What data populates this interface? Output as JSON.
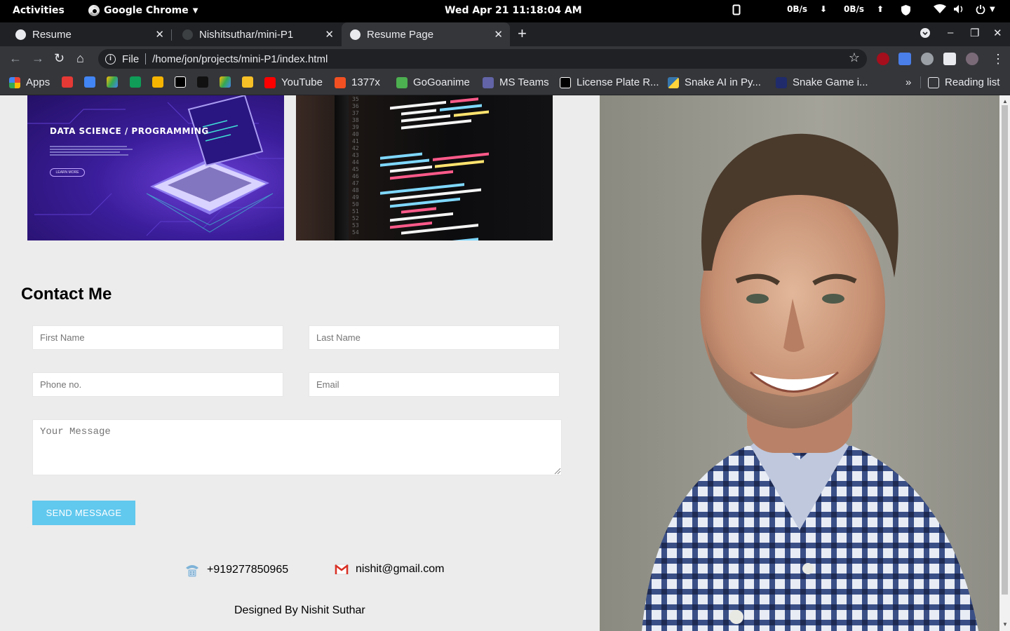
{
  "system_bar": {
    "activities": "Activities",
    "app_name": "Google Chrome",
    "clock": "Wed Apr 21  11:18:04 AM",
    "net_down": "0B/s",
    "net_up": "0B/s"
  },
  "tabs": [
    {
      "title": "Resume",
      "active": false
    },
    {
      "title": "Nishitsuthar/mini-P1",
      "active": false
    },
    {
      "title": "Resume Page",
      "active": true
    }
  ],
  "toolbar": {
    "scheme_label": "File",
    "url": "/home/jon/projects/mini-P1/index.html"
  },
  "bookmarks": {
    "apps": "Apps",
    "items": [
      "YouTube",
      "1377x",
      "GoGoanime",
      "MS Teams",
      "License Plate R...",
      "Snake AI in Py...",
      "Snake Game i..."
    ],
    "overflow": "»",
    "reading_list": "Reading list"
  },
  "page": {
    "card_ds": {
      "title": "DATA SCIENCE / PROGRAMMING",
      "button": "LEARN MORE"
    },
    "contact": {
      "title": "Contact Me",
      "first_name_placeholder": "First Name",
      "last_name_placeholder": "Last Name",
      "phone_placeholder": "Phone no.",
      "email_placeholder": "Email",
      "message_placeholder": "Your Message",
      "send_label": "SEND MESSAGE"
    },
    "info": {
      "phone": "+919277850965",
      "email": "nishit@gmail.com"
    },
    "footer": "Designed By Nishit Suthar"
  },
  "colors": {
    "send_button": "#61c8ee",
    "page_background": "#ececec",
    "chrome_dark": "#35363a"
  }
}
